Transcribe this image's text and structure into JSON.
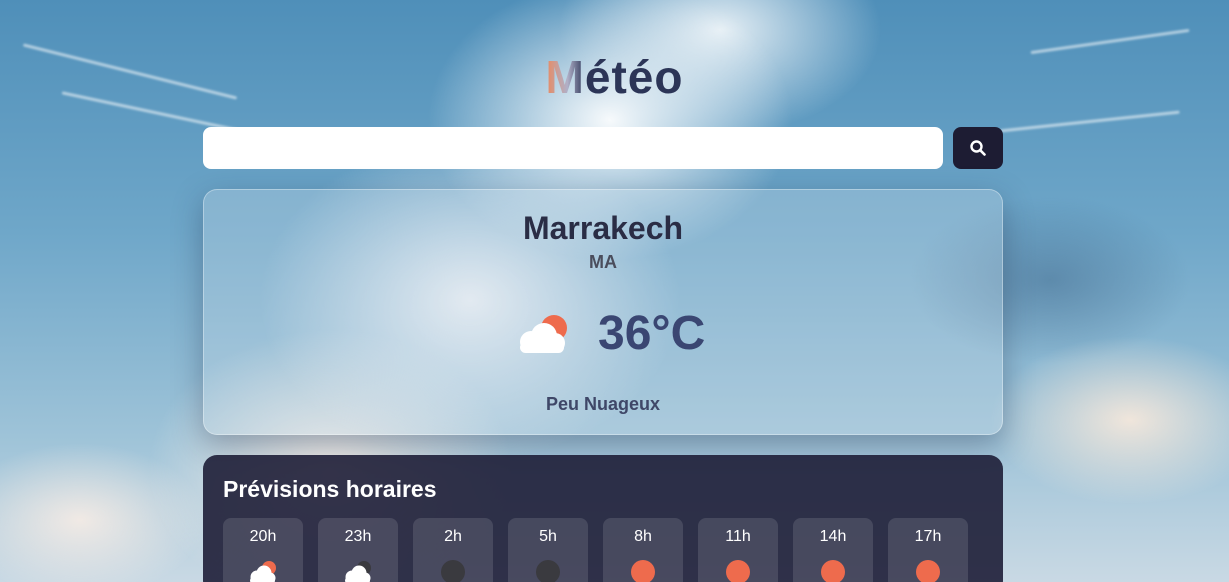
{
  "header": {
    "title_first": "M",
    "title_rest": "étéo"
  },
  "search": {
    "value": "",
    "placeholder": "",
    "button_icon": "search-icon"
  },
  "current": {
    "city": "Marrakech",
    "country": "MA",
    "icon": "cloud-sun-icon",
    "temperature": "36°C",
    "description": "Peu Nuageux"
  },
  "hourly": {
    "title": "Prévisions horaires",
    "items": [
      {
        "time": "20h",
        "icon": "cloud-sun-icon"
      },
      {
        "time": "23h",
        "icon": "cloud-moon-icon"
      },
      {
        "time": "2h",
        "icon": "moon-icon"
      },
      {
        "time": "5h",
        "icon": "moon-icon"
      },
      {
        "time": "8h",
        "icon": "sun-icon"
      },
      {
        "time": "11h",
        "icon": "sun-icon"
      },
      {
        "time": "14h",
        "icon": "sun-icon"
      },
      {
        "time": "17h",
        "icon": "sun-icon"
      }
    ]
  },
  "colors": {
    "accent_dark": "#1d1c33",
    "sun": "#ee6b4d",
    "moon": "#3a3a3f",
    "cloud": "#ffffff",
    "title": "#2c3557"
  }
}
